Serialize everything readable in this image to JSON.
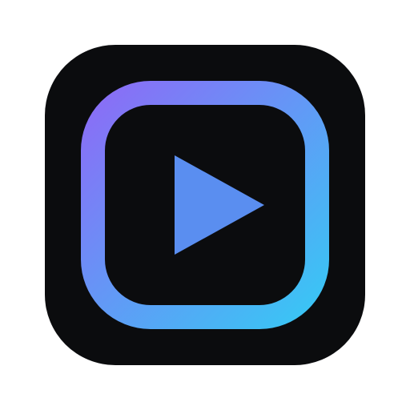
{
  "app_icon": {
    "icon": "play-icon",
    "colors": {
      "background": "#0b0c0e",
      "frame_gradient_start": "#8b6cf6",
      "frame_gradient_end": "#38c7f5",
      "play_triangle": "#5a8ef0"
    }
  }
}
